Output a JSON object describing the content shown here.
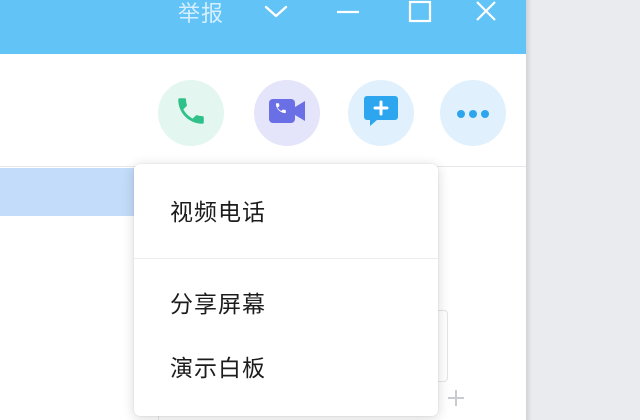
{
  "window": {
    "title": "举报"
  },
  "titlebar_buttons": [
    {
      "name": "collapse-button",
      "icon": "chevron-down-icon"
    },
    {
      "name": "minimize-button",
      "icon": "minimize-icon"
    },
    {
      "name": "maximize-button",
      "icon": "maximize-icon"
    },
    {
      "name": "close-button",
      "icon": "close-icon"
    }
  ],
  "actions": [
    {
      "name": "voice-call-button",
      "icon": "phone-icon",
      "bg": "#e3f6ef",
      "color": "#2fc18a"
    },
    {
      "name": "video-call-button",
      "icon": "video-icon",
      "bg": "#e4e4fb",
      "color": "#6b6fe6"
    },
    {
      "name": "share-button",
      "icon": "chat-plus-icon",
      "bg": "#e0f1fd",
      "color": "#2ea6ef"
    },
    {
      "name": "more-button",
      "icon": "more-icon",
      "bg": "#e0f1fd",
      "color": "#2ea6ef"
    }
  ],
  "dropdown": {
    "items": [
      {
        "label": "视频电话"
      },
      {
        "label": "分享屏幕"
      },
      {
        "label": "演示白板"
      }
    ]
  },
  "colors": {
    "titlebar": "#61c3f6",
    "selected_row": "#c3dcf9"
  }
}
